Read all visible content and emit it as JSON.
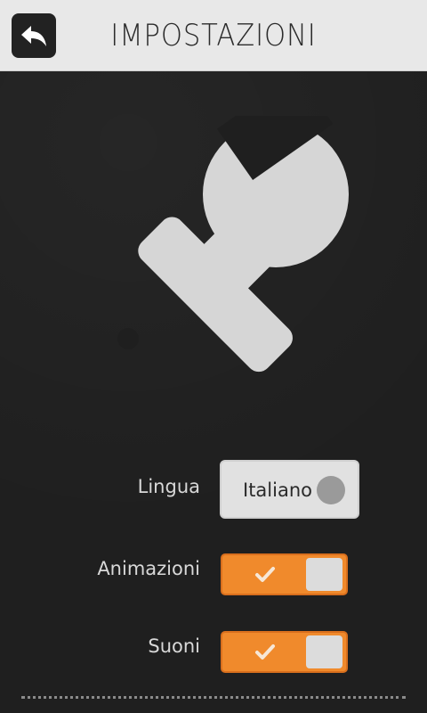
{
  "header": {
    "title": "IMPOSTAZIONI",
    "back_icon": "back-arrow-icon"
  },
  "hero": {
    "icon": "wrench-icon",
    "color": "#d6d6d6"
  },
  "settings": {
    "language": {
      "label": "Lingua",
      "value": "Italiano"
    },
    "animations": {
      "label": "Animazioni",
      "enabled": true
    },
    "sounds": {
      "label": "Suoni",
      "enabled": true
    }
  },
  "colors": {
    "header_bg": "#e8e8e8",
    "page_bg": "#1f1f1f",
    "accent": "#f08a2c"
  }
}
